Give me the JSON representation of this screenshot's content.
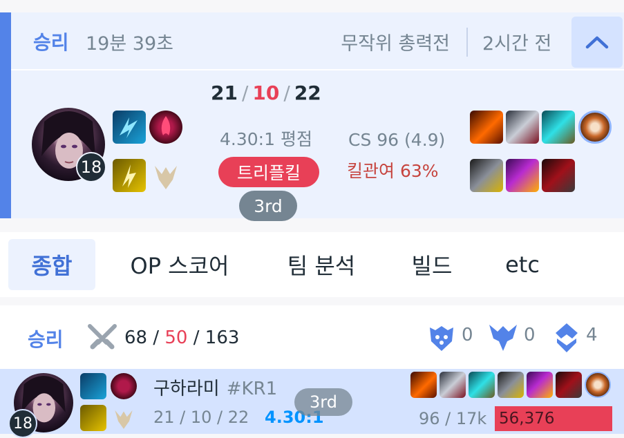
{
  "match": {
    "result": "승리",
    "duration": "19분 39초",
    "queue": "무작위 총력전",
    "time_ago": "2시간 전",
    "champion_level": "18",
    "kda": {
      "kills": "21",
      "deaths": "10",
      "assists": "22",
      "sep": "/"
    },
    "kda_ratio": "4.30:1 평점",
    "multikill": "트리플킬",
    "placement": "3rd",
    "cs": "CS 96 (4.9)",
    "kill_participation": "킬관여 63%",
    "spells": [
      "flash-spell-icon",
      "ignite-spell-icon"
    ],
    "runes": [
      "electrocute-rune-icon",
      "domination-tree-icon"
    ],
    "items": [
      "item-1-icon",
      "item-2-icon",
      "item-3-icon",
      "item-4-icon",
      "item-5-icon",
      "item-6-icon",
      "item-7-icon"
    ]
  },
  "tabs": [
    "종합",
    "OP 스코어",
    "팀 분석",
    "빌드",
    "etc"
  ],
  "team": {
    "result": "승리",
    "kills": "68",
    "deaths": "50",
    "assists": "163",
    "sep": "/",
    "baron": "0",
    "dragon": "0",
    "tower": "4"
  },
  "player": {
    "level": "18",
    "name": "구하라미",
    "tag": "#KR1",
    "kda": "21 / 10 / 22",
    "ratio": "4.30:1",
    "placement": "3rd",
    "cs_gold": "96 / 17k",
    "damage": "56,376"
  },
  "colors": {
    "win_blue": "#5383e8",
    "loss_red": "#e84057",
    "card_bg": "#ecf2fe",
    "row_bg": "#d5e3ff"
  }
}
